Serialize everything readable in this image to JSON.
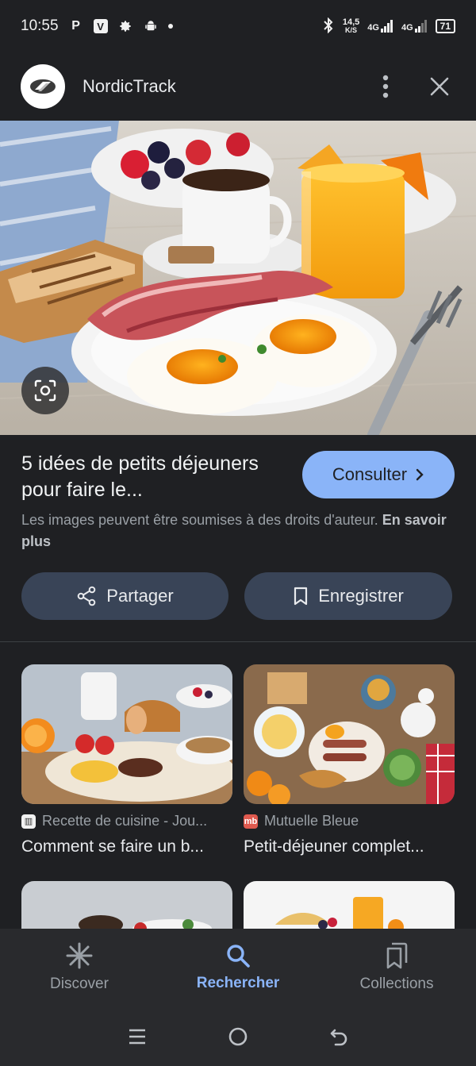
{
  "status_bar": {
    "time": "10:55",
    "speed_top": "14,5",
    "speed_unit": "K/S",
    "net1": "4G",
    "net2": "4G",
    "battery": "71"
  },
  "header": {
    "site_name": "NordicTrack"
  },
  "result": {
    "title": "5 idées de petits déjeuners pour faire le...",
    "visit_label": "Consulter",
    "copyright_text": "Les images peuvent être soumises à des droits d'auteur.",
    "learn_more": "En savoir plus",
    "share_label": "Partager",
    "save_label": "Enregistrer"
  },
  "related": [
    {
      "source": "Recette de cuisine - Jou...",
      "title": "Comment se faire un b..."
    },
    {
      "source": "Mutuelle Bleue",
      "title": "Petit-déjeuner complet..."
    }
  ],
  "bottom_nav": [
    {
      "label": "Discover",
      "icon": "asterisk-icon"
    },
    {
      "label": "Rechercher",
      "icon": "search-icon",
      "active": true
    },
    {
      "label": "Collections",
      "icon": "collections-icon"
    }
  ],
  "colors": {
    "background": "#1f2023",
    "accent": "#8ab4f8",
    "tonal_button": "#394457"
  }
}
